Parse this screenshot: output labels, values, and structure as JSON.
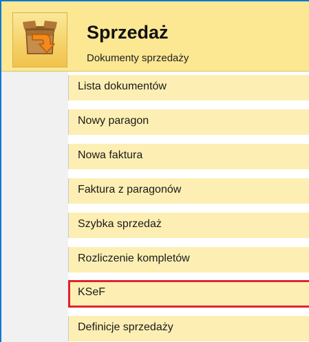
{
  "header": {
    "title": "Sprzedaż",
    "subtitle": "Dokumenty sprzedaży",
    "icon": "sales-arrow-icon"
  },
  "menu": {
    "items": [
      {
        "label": "Lista dokumentów",
        "selected": false
      },
      {
        "label": "Nowy paragon",
        "selected": false
      },
      {
        "label": "Nowa faktura",
        "selected": false
      },
      {
        "label": "Faktura z paragonów",
        "selected": false
      },
      {
        "label": "Szybka sprzedaż",
        "selected": false
      },
      {
        "label": "Rozliczenie kompletów",
        "selected": false
      },
      {
        "label": "KSeF",
        "selected": true
      },
      {
        "label": "Definicje sprzedaży",
        "selected": false
      }
    ]
  },
  "colors": {
    "accent_border": "#0a78d4",
    "header_bg": "#fce792",
    "item_bg": "#fdefb3",
    "selection_outline": "#e0222c"
  }
}
